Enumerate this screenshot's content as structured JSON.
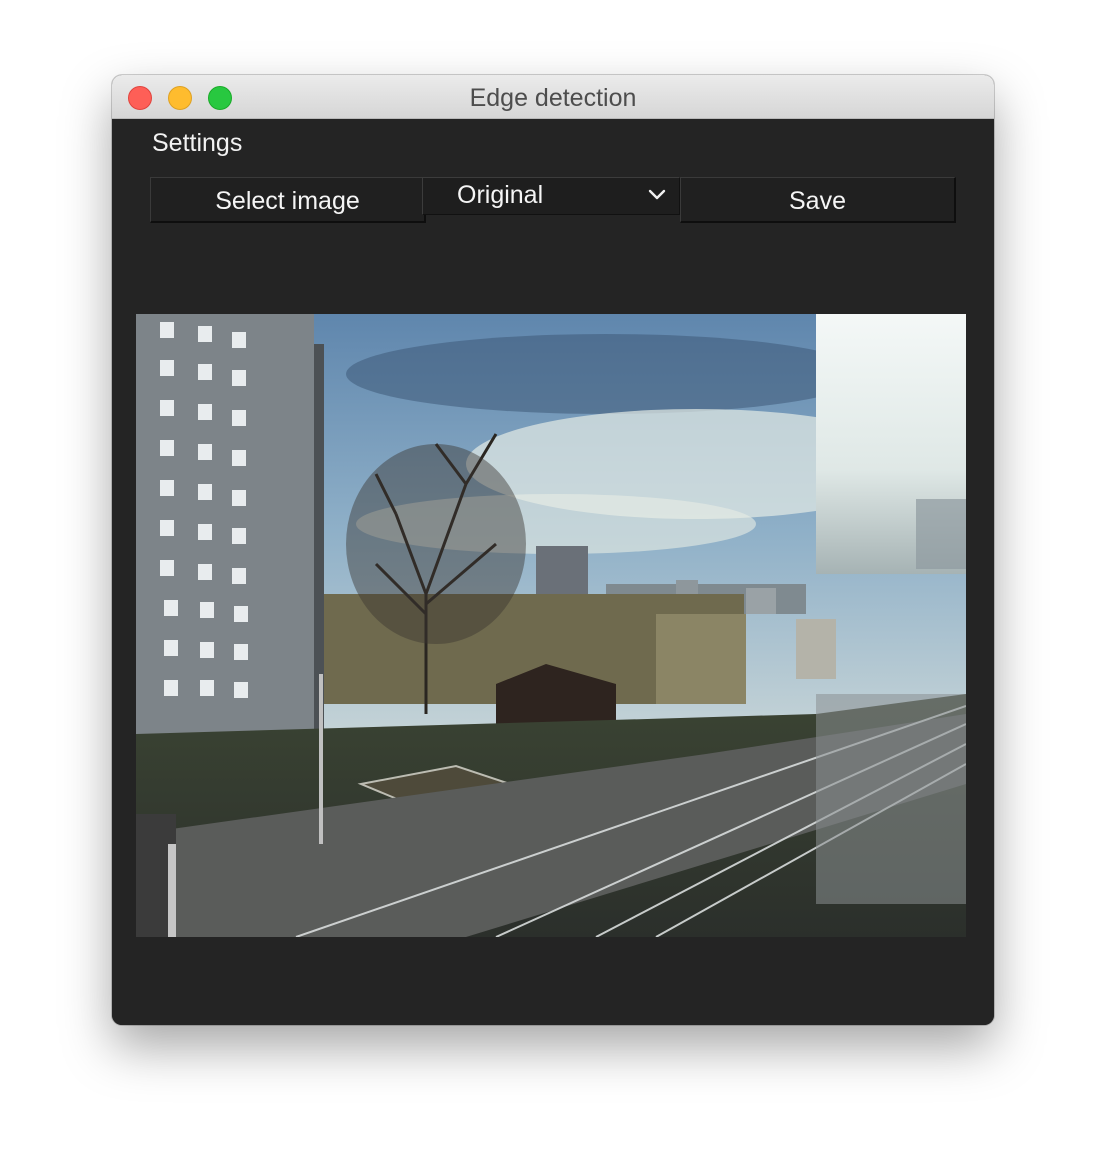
{
  "window": {
    "title": "Edge detection"
  },
  "settings": {
    "label": "Settings",
    "select_image_label": "Select image",
    "mode_selected": "Original",
    "save_label": "Save"
  },
  "image_view": {
    "icon": "photo-icon"
  },
  "colors": {
    "traffic_close": "#fe5f57",
    "traffic_minimize": "#febc2e",
    "traffic_zoom": "#28c840",
    "content_background": "#242424"
  }
}
